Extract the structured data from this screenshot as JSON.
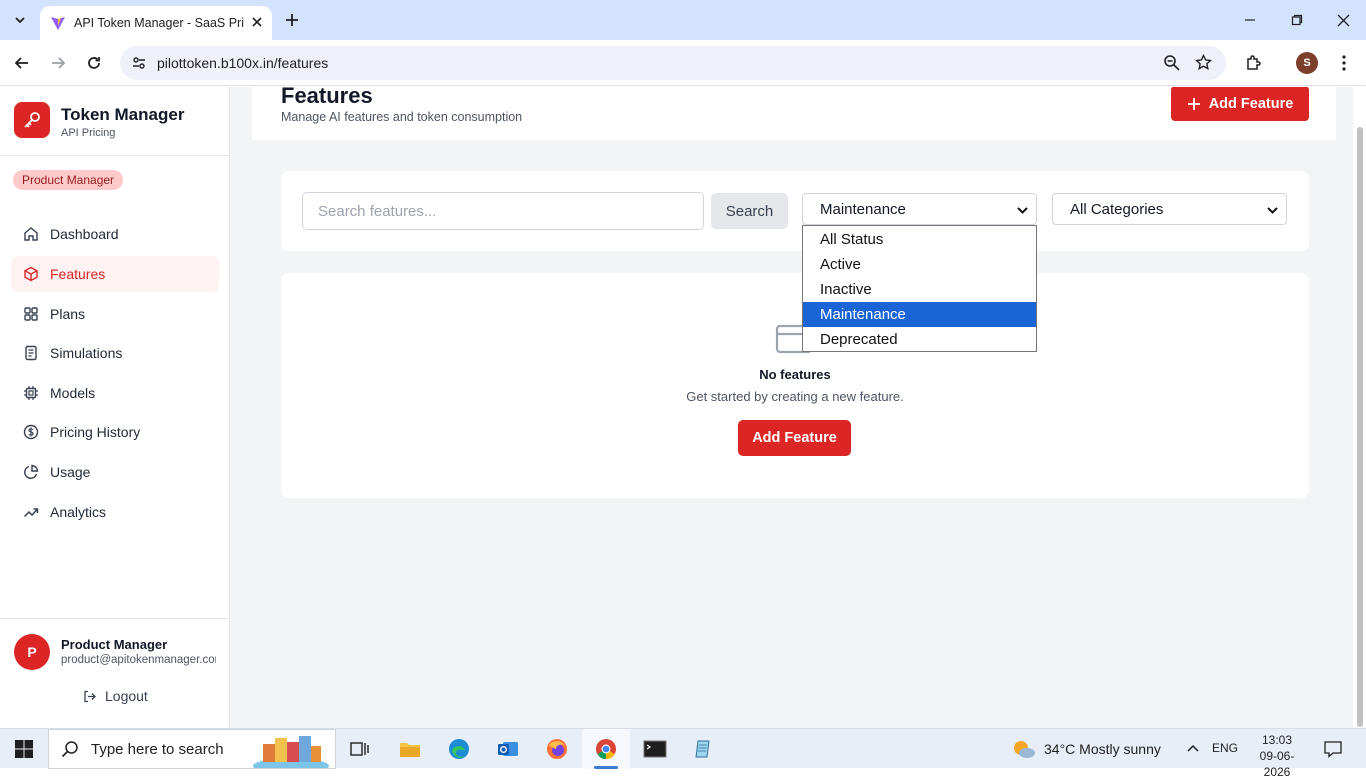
{
  "browser": {
    "tab_title": "API Token Manager - SaaS Pricing",
    "url": "pilottoken.b100x.in/features",
    "profile_initial": "S"
  },
  "sidebar": {
    "brand_name": "Token Manager",
    "brand_subtitle": "API Pricing",
    "role_badge": "Product Manager",
    "items": [
      {
        "label": "Dashboard",
        "icon": "home-icon",
        "active": false
      },
      {
        "label": "Features",
        "icon": "cube-icon",
        "active": true
      },
      {
        "label": "Plans",
        "icon": "grid-icon",
        "active": false
      },
      {
        "label": "Simulations",
        "icon": "document-icon",
        "active": false
      },
      {
        "label": "Models",
        "icon": "chip-icon",
        "active": false
      },
      {
        "label": "Pricing History",
        "icon": "dollar-icon",
        "active": false
      },
      {
        "label": "Usage",
        "icon": "pie-chart-icon",
        "active": false
      },
      {
        "label": "Analytics",
        "icon": "trending-up-icon",
        "active": false
      }
    ],
    "user": {
      "initial": "P",
      "name": "Product Manager",
      "email": "product@apitokenmanager.com"
    },
    "logout_label": "Logout"
  },
  "header": {
    "title": "Features",
    "subtitle": "Manage AI features and token consumption",
    "add_button_label": "Add Feature"
  },
  "filters": {
    "search_placeholder": "Search features...",
    "search_value": "",
    "search_button_label": "Search",
    "status_selected": "Maintenance",
    "status_options": [
      "All Status",
      "Active",
      "Inactive",
      "Maintenance",
      "Deprecated"
    ],
    "category_selected": "All Categories"
  },
  "empty_state": {
    "title": "No features",
    "description": "Get started by creating a new feature.",
    "button_label": "Add Feature"
  },
  "taskbar": {
    "search_placeholder": "Type here to search",
    "weather_temp": "34°C",
    "weather_desc": "Mostly sunny",
    "language": "ENG",
    "time": "13:03",
    "date": "09-06-2026"
  },
  "colors": {
    "accent": "#dc2626",
    "active_nav_bg": "#fef2f2",
    "selected_option": "#1a65d6",
    "tabbar": "#d3e3fd"
  }
}
